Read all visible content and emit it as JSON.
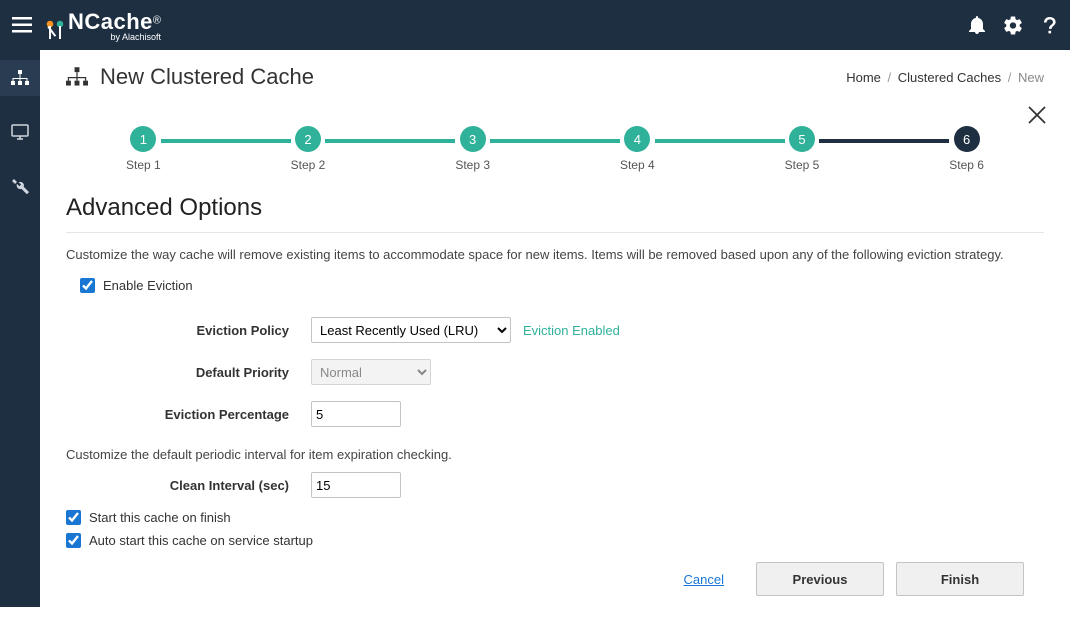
{
  "header": {
    "product": "NCache",
    "byline": "by Alachisoft"
  },
  "page": {
    "iconTitle": "New Clustered Cache",
    "breadcrumb": {
      "home": "Home",
      "mid": "Clustered Caches",
      "current": "New"
    }
  },
  "stepper": {
    "steps": [
      {
        "num": "1",
        "label": "Step 1"
      },
      {
        "num": "2",
        "label": "Step 2"
      },
      {
        "num": "3",
        "label": "Step 3"
      },
      {
        "num": "4",
        "label": "Step 4"
      },
      {
        "num": "5",
        "label": "Step 5"
      },
      {
        "num": "6",
        "label": "Step 6"
      }
    ]
  },
  "section": {
    "title": "Advanced Options",
    "evictionDesc": "Customize the way cache will remove existing items to accommodate space for new items. Items will be removed based upon any of the following eviction strategy.",
    "enableEvictionLabel": "Enable Eviction",
    "evictionHint": "Eviction Enabled",
    "expirationDesc": "Customize the default periodic interval for item expiration checking.",
    "startOnFinish": "Start this cache on finish",
    "autoStart": "Auto start this cache on service startup"
  },
  "form": {
    "policyLabel": "Eviction Policy",
    "policyValue": "Least Recently Used (LRU)",
    "priorityLabel": "Default Priority",
    "priorityValue": "Normal",
    "percentLabel": "Eviction Percentage",
    "percentValue": "5",
    "cleanLabel": "Clean Interval (sec)",
    "cleanValue": "15"
  },
  "footer": {
    "cancel": "Cancel",
    "previous": "Previous",
    "finish": "Finish"
  }
}
